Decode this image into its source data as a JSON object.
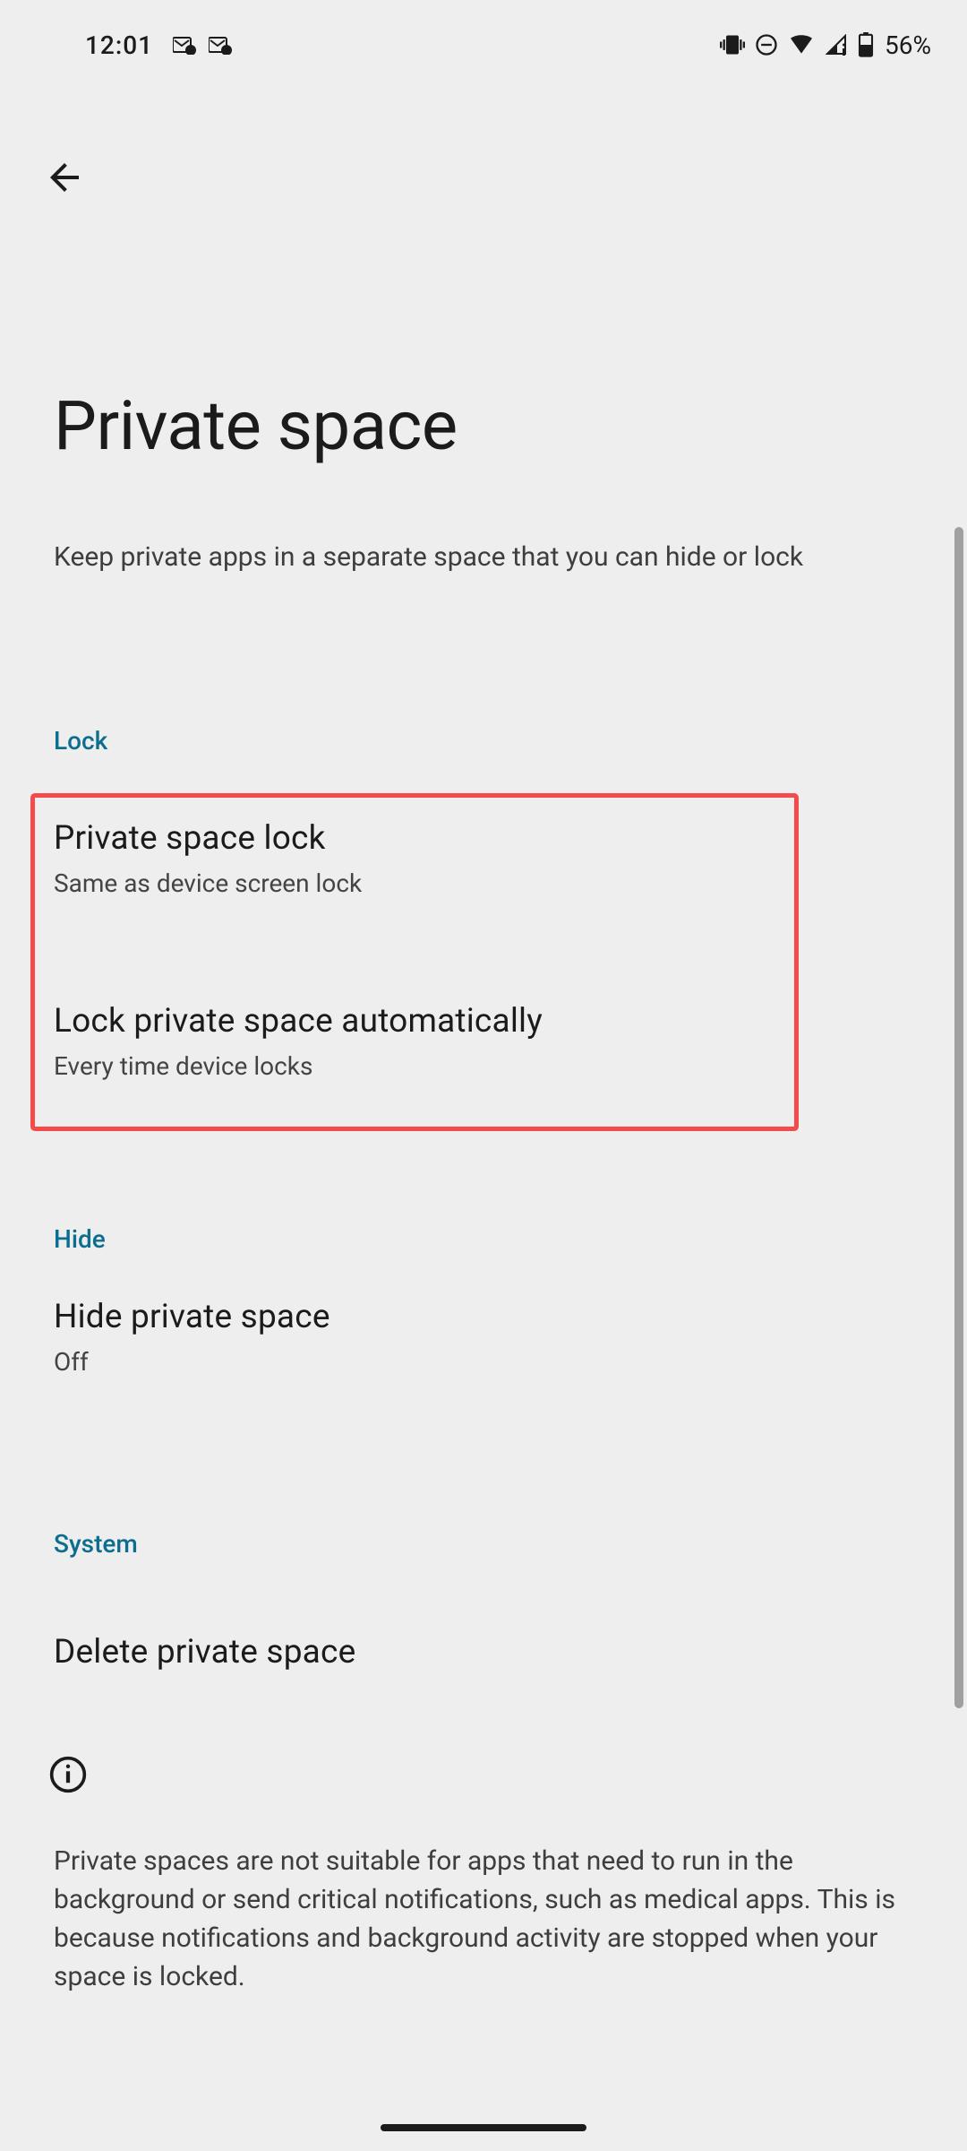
{
  "status_bar": {
    "time": "12:01",
    "battery_percent": "56%"
  },
  "page": {
    "title": "Private space",
    "subtitle": "Keep private apps in a separate space that you can hide or lock"
  },
  "sections": {
    "lock": {
      "header": "Lock",
      "items": [
        {
          "title": "Private space lock",
          "subtitle": "Same as device screen lock"
        },
        {
          "title": "Lock private space automatically",
          "subtitle": "Every time device locks"
        }
      ]
    },
    "hide": {
      "header": "Hide",
      "items": [
        {
          "title": "Hide private space",
          "subtitle": "Off"
        }
      ]
    },
    "system": {
      "header": "System",
      "items": [
        {
          "title": "Delete private space"
        }
      ]
    }
  },
  "info": {
    "text": "Private spaces are not suitable for apps that need to run in the background or send critical notifications, such as medical apps. This is because notifications and background activity are stopped when your space is locked."
  }
}
